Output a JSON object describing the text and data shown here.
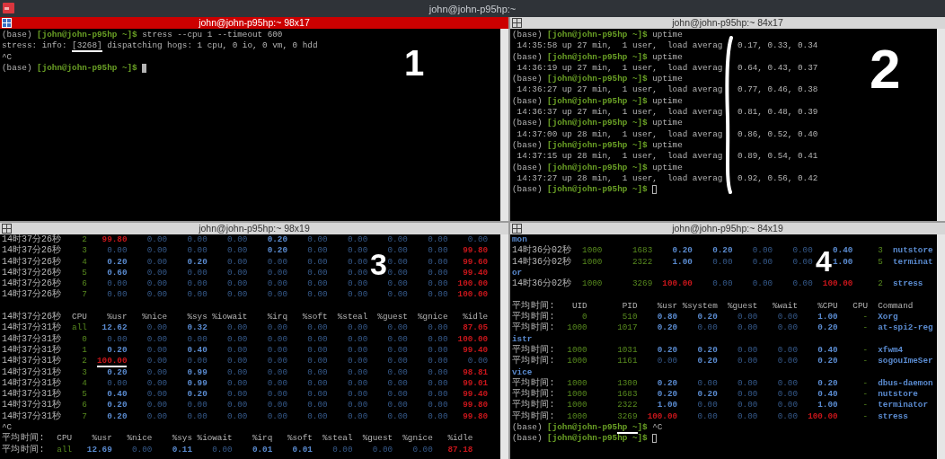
{
  "window": {
    "title": "john@john-p95hp:~"
  },
  "panes": [
    {
      "title": "john@john-p95hp:~ 98x17",
      "focused": true,
      "kind": "shell",
      "annotation": "1",
      "lines": [
        {
          "kind": "text",
          "segments": [
            {
              "text": "(base) ",
              "kind": "plain"
            },
            {
              "text": "[john@john-p95hp ~]$",
              "kind": "prompt"
            },
            {
              "text": " stress --cpu 1 --timeout 600",
              "kind": "plain"
            }
          ]
        },
        {
          "kind": "text",
          "segments": [
            {
              "text": "stress: info: ",
              "kind": "plain"
            },
            {
              "text": "[3268]",
              "kind": "plain",
              "underlined": true
            },
            {
              "text": " dispatching hogs: 1 cpu, 0 io, 0 vm, 0 hdd",
              "kind": "plain"
            }
          ]
        },
        {
          "kind": "text",
          "segments": [
            {
              "text": "^C",
              "kind": "plain"
            }
          ]
        },
        {
          "kind": "text",
          "segments": [
            {
              "text": "(base) ",
              "kind": "plain"
            },
            {
              "text": "[john@john-p95hp ~]$",
              "kind": "prompt"
            }
          ],
          "cursor": true
        }
      ]
    },
    {
      "title": "john@john-p95hp:~ 84x17",
      "focused": false,
      "kind": "shell",
      "annotation": "2",
      "bracket": true,
      "lines": [
        {
          "kind": "text",
          "segments": [
            {
              "text": "(base) ",
              "kind": "plain"
            },
            {
              "text": "[john@john-p95hp ~]$",
              "kind": "prompt"
            },
            {
              "text": " uptime",
              "kind": "plain"
            }
          ]
        },
        {
          "kind": "text",
          "segments": [
            {
              "text": " 14:35:58 up 27 min,  1 user,  load averag   0.17, 0.33, 0.34",
              "kind": "plain"
            }
          ]
        },
        {
          "kind": "text",
          "segments": [
            {
              "text": "(base) ",
              "kind": "plain"
            },
            {
              "text": "[john@john-p95hp ~]$",
              "kind": "prompt"
            },
            {
              "text": " uptime",
              "kind": "plain"
            }
          ]
        },
        {
          "kind": "text",
          "segments": [
            {
              "text": " 14:36:19 up 27 min,  1 user,  load averag   0.64, 0.43, 0.37",
              "kind": "plain"
            }
          ]
        },
        {
          "kind": "text",
          "segments": [
            {
              "text": "(base) ",
              "kind": "plain"
            },
            {
              "text": "[john@john-p95hp ~]$",
              "kind": "prompt"
            },
            {
              "text": " uptime",
              "kind": "plain"
            }
          ]
        },
        {
          "kind": "text",
          "segments": [
            {
              "text": " 14:36:27 up 27 min,  1 user,  load averag   0.77, 0.46, 0.38",
              "kind": "plain"
            }
          ]
        },
        {
          "kind": "text",
          "segments": [
            {
              "text": "(base) ",
              "kind": "plain"
            },
            {
              "text": "[john@john-p95hp ~]$",
              "kind": "prompt"
            },
            {
              "text": " uptime",
              "kind": "plain"
            }
          ]
        },
        {
          "kind": "text",
          "segments": [
            {
              "text": " 14:36:37 up 27 min,  1 user,  load averag   0.81, 0.48, 0.39",
              "kind": "plain"
            }
          ]
        },
        {
          "kind": "text",
          "segments": [
            {
              "text": "(base) ",
              "kind": "plain"
            },
            {
              "text": "[john@john-p95hp ~]$",
              "kind": "prompt"
            },
            {
              "text": " uptime",
              "kind": "plain"
            }
          ]
        },
        {
          "kind": "text",
          "segments": [
            {
              "text": " 14:37:00 up 28 min,  1 user,  load averag   0.86, 0.52, 0.40",
              "kind": "plain"
            }
          ]
        },
        {
          "kind": "text",
          "segments": [
            {
              "text": "(base) ",
              "kind": "plain"
            },
            {
              "text": "[john@john-p95hp ~]$",
              "kind": "prompt"
            },
            {
              "text": " uptime",
              "kind": "plain"
            }
          ]
        },
        {
          "kind": "text",
          "segments": [
            {
              "text": " 14:37:15 up 28 min,  1 user,  load averag   0.89, 0.54, 0.41",
              "kind": "plain"
            }
          ]
        },
        {
          "kind": "text",
          "segments": [
            {
              "text": "(base) ",
              "kind": "plain"
            },
            {
              "text": "[john@john-p95hp ~]$",
              "kind": "prompt"
            },
            {
              "text": " uptime",
              "kind": "plain"
            }
          ]
        },
        {
          "kind": "text",
          "segments": [
            {
              "text": " 14:37:27 up 28 min,  1 user,  load averag   0.92, 0.56, 0.42",
              "kind": "plain"
            }
          ]
        },
        {
          "kind": "text",
          "segments": [
            {
              "text": "(base) ",
              "kind": "plain"
            },
            {
              "text": "[john@john-p95hp ~]$",
              "kind": "prompt"
            }
          ],
          "cursor": true
        }
      ]
    },
    {
      "title": "john@john-p95hp:~ 98x19",
      "focused": false,
      "kind": "cpu_table",
      "annotation": "3",
      "lines": [
        {
          "kind": "timed_row",
          "label": "14时37分26秒",
          "cells": [
            {
              "text": "2",
              "kind": "id"
            },
            {
              "text": "99.80",
              "kind": "alert"
            },
            {
              "text": "0.00",
              "kind": "value"
            },
            {
              "text": "0.00",
              "kind": "value"
            },
            {
              "text": "0.00",
              "kind": "value"
            },
            {
              "text": "0.20",
              "kind": "highlight"
            },
            {
              "text": "0.00",
              "kind": "value"
            },
            {
              "text": "0.00",
              "kind": "value"
            },
            {
              "text": "0.00",
              "kind": "value"
            },
            {
              "text": "0.00",
              "kind": "value"
            },
            {
              "text": "0.00",
              "kind": "value"
            }
          ]
        },
        {
          "kind": "timed_row",
          "label": "14时37分26秒",
          "cells": [
            {
              "text": "3",
              "kind": "id"
            },
            {
              "text": "0.00",
              "kind": "value"
            },
            {
              "text": "0.00",
              "kind": "value"
            },
            {
              "text": "0.00",
              "kind": "value"
            },
            {
              "text": "0.00",
              "kind": "value"
            },
            {
              "text": "0.20",
              "kind": "highlight"
            },
            {
              "text": "0.00",
              "kind": "value"
            },
            {
              "text": "0.00",
              "kind": "value"
            },
            {
              "text": "0.00",
              "kind": "value"
            },
            {
              "text": "0.00",
              "kind": "value"
            },
            {
              "text": "99.80",
              "kind": "alert"
            }
          ]
        },
        {
          "kind": "timed_row",
          "label": "14时37分26秒",
          "cells": [
            {
              "text": "4",
              "kind": "id"
            },
            {
              "text": "0.20",
              "kind": "highlight"
            },
            {
              "text": "0.00",
              "kind": "value"
            },
            {
              "text": "0.20",
              "kind": "highlight"
            },
            {
              "text": "0.00",
              "kind": "value"
            },
            {
              "text": "0.00",
              "kind": "value"
            },
            {
              "text": "0.00",
              "kind": "value"
            },
            {
              "text": "0.00",
              "kind": "value"
            },
            {
              "text": "0.00",
              "kind": "value"
            },
            {
              "text": "0.00",
              "kind": "value"
            },
            {
              "text": "99.60",
              "kind": "alert"
            }
          ]
        },
        {
          "kind": "timed_row",
          "label": "14时37分26秒",
          "cells": [
            {
              "text": "5",
              "kind": "id"
            },
            {
              "text": "0.60",
              "kind": "highlight"
            },
            {
              "text": "0.00",
              "kind": "value"
            },
            {
              "text": "0.00",
              "kind": "value"
            },
            {
              "text": "0.00",
              "kind": "value"
            },
            {
              "text": "0.00",
              "kind": "value"
            },
            {
              "text": "0.00",
              "kind": "value"
            },
            {
              "text": "0.00",
              "kind": "value"
            },
            {
              "text": "0.00",
              "kind": "value"
            },
            {
              "text": "0.00",
              "kind": "value"
            },
            {
              "text": "99.40",
              "kind": "alert"
            }
          ]
        },
        {
          "kind": "timed_row",
          "label": "14时37分26秒",
          "cells": [
            {
              "text": "6",
              "kind": "id"
            },
            {
              "text": "0.00",
              "kind": "value"
            },
            {
              "text": "0.00",
              "kind": "value"
            },
            {
              "text": "0.00",
              "kind": "value"
            },
            {
              "text": "0.00",
              "kind": "value"
            },
            {
              "text": "0.00",
              "kind": "value"
            },
            {
              "text": "0.00",
              "kind": "value"
            },
            {
              "text": "0.00",
              "kind": "value"
            },
            {
              "text": "0.00",
              "kind": "value"
            },
            {
              "text": "0.00",
              "kind": "value"
            },
            {
              "text": "100.00",
              "kind": "alert"
            }
          ]
        },
        {
          "kind": "timed_row",
          "label": "14时37分26秒",
          "cells": [
            {
              "text": "7",
              "kind": "id"
            },
            {
              "text": "0.00",
              "kind": "value"
            },
            {
              "text": "0.00",
              "kind": "value"
            },
            {
              "text": "0.00",
              "kind": "value"
            },
            {
              "text": "0.00",
              "kind": "value"
            },
            {
              "text": "0.00",
              "kind": "value"
            },
            {
              "text": "0.00",
              "kind": "value"
            },
            {
              "text": "0.00",
              "kind": "value"
            },
            {
              "text": "0.00",
              "kind": "value"
            },
            {
              "text": "0.00",
              "kind": "value"
            },
            {
              "text": "100.00",
              "kind": "alert"
            }
          ]
        },
        {
          "kind": "blank"
        },
        {
          "kind": "timed_row",
          "label": "14时37分26秒",
          "cells": [
            {
              "text": "CPU",
              "kind": "plain"
            },
            {
              "text": "%usr",
              "kind": "plain"
            },
            {
              "text": "%nice",
              "kind": "plain"
            },
            {
              "text": "%sys",
              "kind": "plain"
            },
            {
              "text": "%iowait",
              "kind": "plain"
            },
            {
              "text": "%irq",
              "kind": "plain"
            },
            {
              "text": "%soft",
              "kind": "plain"
            },
            {
              "text": "%steal",
              "kind": "plain"
            },
            {
              "text": "%guest",
              "kind": "plain"
            },
            {
              "text": "%gnice",
              "kind": "plain"
            },
            {
              "text": "%idle",
              "kind": "plain"
            }
          ]
        },
        {
          "kind": "timed_row",
          "label": "14时37分31秒",
          "cells": [
            {
              "text": "all",
              "kind": "id"
            },
            {
              "text": "12.62",
              "kind": "highlight"
            },
            {
              "text": "0.00",
              "kind": "value"
            },
            {
              "text": "0.32",
              "kind": "highlight"
            },
            {
              "text": "0.00",
              "kind": "value"
            },
            {
              "text": "0.00",
              "kind": "value"
            },
            {
              "text": "0.00",
              "kind": "value"
            },
            {
              "text": "0.00",
              "kind": "value"
            },
            {
              "text": "0.00",
              "kind": "value"
            },
            {
              "text": "0.00",
              "kind": "value"
            },
            {
              "text": "87.05",
              "kind": "alert"
            }
          ]
        },
        {
          "kind": "timed_row",
          "label": "14时37分31秒",
          "cells": [
            {
              "text": "0",
              "kind": "id"
            },
            {
              "text": "0.00",
              "kind": "value"
            },
            {
              "text": "0.00",
              "kind": "value"
            },
            {
              "text": "0.00",
              "kind": "value"
            },
            {
              "text": "0.00",
              "kind": "value"
            },
            {
              "text": "0.00",
              "kind": "value"
            },
            {
              "text": "0.00",
              "kind": "value"
            },
            {
              "text": "0.00",
              "kind": "value"
            },
            {
              "text": "0.00",
              "kind": "value"
            },
            {
              "text": "0.00",
              "kind": "value"
            },
            {
              "text": "100.00",
              "kind": "alert"
            }
          ]
        },
        {
          "kind": "timed_row",
          "label": "14时37分31秒",
          "cells": [
            {
              "text": "1",
              "kind": "id"
            },
            {
              "text": "0.20",
              "kind": "highlight"
            },
            {
              "text": "0.00",
              "kind": "value"
            },
            {
              "text": "0.40",
              "kind": "highlight"
            },
            {
              "text": "0.00",
              "kind": "value"
            },
            {
              "text": "0.00",
              "kind": "value"
            },
            {
              "text": "0.00",
              "kind": "value"
            },
            {
              "text": "0.00",
              "kind": "value"
            },
            {
              "text": "0.00",
              "kind": "value"
            },
            {
              "text": "0.00",
              "kind": "value"
            },
            {
              "text": "99.40",
              "kind": "alert"
            }
          ]
        },
        {
          "kind": "timed_row",
          "label": "14时37分31秒",
          "cells": [
            {
              "text": "2",
              "kind": "id"
            },
            {
              "text": "100.00",
              "kind": "alert",
              "underlined": true
            },
            {
              "text": "0.00",
              "kind": "value"
            },
            {
              "text": "0.00",
              "kind": "value"
            },
            {
              "text": "0.00",
              "kind": "value"
            },
            {
              "text": "0.00",
              "kind": "value"
            },
            {
              "text": "0.00",
              "kind": "value"
            },
            {
              "text": "0.00",
              "kind": "value"
            },
            {
              "text": "0.00",
              "kind": "value"
            },
            {
              "text": "0.00",
              "kind": "value"
            },
            {
              "text": "0.00",
              "kind": "value"
            }
          ]
        },
        {
          "kind": "timed_row",
          "label": "14时37分31秒",
          "cells": [
            {
              "text": "3",
              "kind": "id"
            },
            {
              "text": "0.20",
              "kind": "highlight"
            },
            {
              "text": "0.00",
              "kind": "value"
            },
            {
              "text": "0.99",
              "kind": "highlight"
            },
            {
              "text": "0.00",
              "kind": "value"
            },
            {
              "text": "0.00",
              "kind": "value"
            },
            {
              "text": "0.00",
              "kind": "value"
            },
            {
              "text": "0.00",
              "kind": "value"
            },
            {
              "text": "0.00",
              "kind": "value"
            },
            {
              "text": "0.00",
              "kind": "value"
            },
            {
              "text": "98.81",
              "kind": "alert"
            }
          ]
        },
        {
          "kind": "timed_row",
          "label": "14时37分31秒",
          "cells": [
            {
              "text": "4",
              "kind": "id"
            },
            {
              "text": "0.00",
              "kind": "value"
            },
            {
              "text": "0.00",
              "kind": "value"
            },
            {
              "text": "0.99",
              "kind": "highlight"
            },
            {
              "text": "0.00",
              "kind": "value"
            },
            {
              "text": "0.00",
              "kind": "value"
            },
            {
              "text": "0.00",
              "kind": "value"
            },
            {
              "text": "0.00",
              "kind": "value"
            },
            {
              "text": "0.00",
              "kind": "value"
            },
            {
              "text": "0.00",
              "kind": "value"
            },
            {
              "text": "99.01",
              "kind": "alert"
            }
          ]
        },
        {
          "kind": "timed_row",
          "label": "14时37分31秒",
          "cells": [
            {
              "text": "5",
              "kind": "id"
            },
            {
              "text": "0.40",
              "kind": "highlight"
            },
            {
              "text": "0.00",
              "kind": "value"
            },
            {
              "text": "0.20",
              "kind": "highlight"
            },
            {
              "text": "0.00",
              "kind": "value"
            },
            {
              "text": "0.00",
              "kind": "value"
            },
            {
              "text": "0.00",
              "kind": "value"
            },
            {
              "text": "0.00",
              "kind": "value"
            },
            {
              "text": "0.00",
              "kind": "value"
            },
            {
              "text": "0.00",
              "kind": "value"
            },
            {
              "text": "99.40",
              "kind": "alert"
            }
          ]
        },
        {
          "kind": "timed_row",
          "label": "14时37分31秒",
          "cells": [
            {
              "text": "6",
              "kind": "id"
            },
            {
              "text": "0.20",
              "kind": "highlight"
            },
            {
              "text": "0.00",
              "kind": "value"
            },
            {
              "text": "0.00",
              "kind": "value"
            },
            {
              "text": "0.00",
              "kind": "value"
            },
            {
              "text": "0.00",
              "kind": "value"
            },
            {
              "text": "0.00",
              "kind": "value"
            },
            {
              "text": "0.00",
              "kind": "value"
            },
            {
              "text": "0.00",
              "kind": "value"
            },
            {
              "text": "0.00",
              "kind": "value"
            },
            {
              "text": "99.80",
              "kind": "alert"
            }
          ]
        },
        {
          "kind": "timed_row",
          "label": "14时37分31秒",
          "cells": [
            {
              "text": "7",
              "kind": "id"
            },
            {
              "text": "0.20",
              "kind": "highlight"
            },
            {
              "text": "0.00",
              "kind": "value"
            },
            {
              "text": "0.00",
              "kind": "value"
            },
            {
              "text": "0.00",
              "kind": "value"
            },
            {
              "text": "0.00",
              "kind": "value"
            },
            {
              "text": "0.00",
              "kind": "value"
            },
            {
              "text": "0.00",
              "kind": "value"
            },
            {
              "text": "0.00",
              "kind": "value"
            },
            {
              "text": "0.00",
              "kind": "value"
            },
            {
              "text": "99.80",
              "kind": "alert"
            }
          ]
        },
        {
          "kind": "text",
          "segments": [
            {
              "text": "^C",
              "kind": "plain"
            }
          ]
        },
        {
          "kind": "average_row",
          "label": "平均时间:",
          "cells": [
            {
              "text": "CPU",
              "kind": "plain"
            },
            {
              "text": "%usr",
              "kind": "plain"
            },
            {
              "text": "%nice",
              "kind": "plain"
            },
            {
              "text": "%sys",
              "kind": "plain"
            },
            {
              "text": "%iowait",
              "kind": "plain"
            },
            {
              "text": "%irq",
              "kind": "plain"
            },
            {
              "text": "%soft",
              "kind": "plain"
            },
            {
              "text": "%steal",
              "kind": "plain"
            },
            {
              "text": "%guest",
              "kind": "plain"
            },
            {
              "text": "%gnice",
              "kind": "plain"
            },
            {
              "text": "%idle",
              "kind": "plain"
            }
          ]
        },
        {
          "kind": "average_row",
          "label": "平均时间:",
          "cells": [
            {
              "text": "all",
              "kind": "id"
            },
            {
              "text": "12.69",
              "kind": "highlight"
            },
            {
              "text": "0.00",
              "kind": "value"
            },
            {
              "text": "0.11",
              "kind": "highlight"
            },
            {
              "text": "0.00",
              "kind": "value"
            },
            {
              "text": "0.01",
              "kind": "highlight"
            },
            {
              "text": "0.01",
              "kind": "highlight"
            },
            {
              "text": "0.00",
              "kind": "value"
            },
            {
              "text": "0.00",
              "kind": "value"
            },
            {
              "text": "0.00",
              "kind": "value"
            },
            {
              "text": "87.18",
              "kind": "alert"
            }
          ]
        }
      ]
    },
    {
      "title": "john@john-p95hp:~ 84x19",
      "focused": false,
      "kind": "process_table",
      "annotation": "4",
      "lines": [
        {
          "kind": "text",
          "segments": [
            {
              "text": "mon",
              "kind": "highlight"
            }
          ]
        },
        {
          "kind": "timed_row",
          "label": "14时36分02秒",
          "cells": [
            {
              "text": "1000",
              "kind": "id"
            },
            {
              "text": "1683",
              "kind": "id"
            },
            {
              "text": "0.20",
              "kind": "highlight"
            },
            {
              "text": "0.20",
              "kind": "highlight"
            },
            {
              "text": "0.00",
              "kind": "value"
            },
            {
              "text": "0.00",
              "kind": "value"
            },
            {
              "text": "0.40",
              "kind": "highlight"
            },
            {
              "text": "3",
              "kind": "id"
            },
            {
              "text": "nutstore",
              "kind": "highlight"
            }
          ]
        },
        {
          "kind": "timed_row",
          "label": "14时36分02秒",
          "cells": [
            {
              "text": "1000",
              "kind": "id"
            },
            {
              "text": "2322",
              "kind": "id"
            },
            {
              "text": "1.00",
              "kind": "highlight"
            },
            {
              "text": "0.00",
              "kind": "value"
            },
            {
              "text": "0.00",
              "kind": "value"
            },
            {
              "text": "0.00",
              "kind": "value"
            },
            {
              "text": "1.00",
              "kind": "highlight"
            },
            {
              "text": "5",
              "kind": "id"
            },
            {
              "text": "terminat",
              "kind": "highlight"
            }
          ]
        },
        {
          "kind": "text",
          "segments": [
            {
              "text": "or",
              "kind": "highlight"
            }
          ]
        },
        {
          "kind": "timed_row",
          "label": "14时36分02秒",
          "cells": [
            {
              "text": "1000",
              "kind": "id"
            },
            {
              "text": "3269",
              "kind": "id"
            },
            {
              "text": "100.00",
              "kind": "alert"
            },
            {
              "text": "0.00",
              "kind": "value"
            },
            {
              "text": "0.00",
              "kind": "value"
            },
            {
              "text": "0.00",
              "kind": "value"
            },
            {
              "text": "100.00",
              "kind": "alert"
            },
            {
              "text": "2",
              "kind": "id"
            },
            {
              "text": "stress",
              "kind": "highlight"
            }
          ]
        },
        {
          "kind": "blank"
        },
        {
          "kind": "average_row",
          "label": "平均时间:",
          "cells": [
            {
              "text": "UID",
              "kind": "plain"
            },
            {
              "text": "PID",
              "kind": "plain"
            },
            {
              "text": "%usr",
              "kind": "plain"
            },
            {
              "text": "%system",
              "kind": "plain"
            },
            {
              "text": "%guest",
              "kind": "plain"
            },
            {
              "text": "%wait",
              "kind": "plain"
            },
            {
              "text": "%CPU",
              "kind": "plain"
            },
            {
              "text": "CPU",
              "kind": "plain"
            },
            {
              "text": "Command",
              "kind": "plain"
            }
          ]
        },
        {
          "kind": "average_row",
          "label": "平均时间:",
          "cells": [
            {
              "text": "0",
              "kind": "id"
            },
            {
              "text": "510",
              "kind": "id"
            },
            {
              "text": "0.80",
              "kind": "highlight"
            },
            {
              "text": "0.20",
              "kind": "highlight"
            },
            {
              "text": "0.00",
              "kind": "value"
            },
            {
              "text": "0.00",
              "kind": "value"
            },
            {
              "text": "1.00",
              "kind": "highlight"
            },
            {
              "text": "-",
              "kind": "id"
            },
            {
              "text": "Xorg",
              "kind": "highlight"
            }
          ]
        },
        {
          "kind": "average_row",
          "label": "平均时间:",
          "cells": [
            {
              "text": "1000",
              "kind": "id"
            },
            {
              "text": "1017",
              "kind": "id"
            },
            {
              "text": "0.20",
              "kind": "highlight"
            },
            {
              "text": "0.00",
              "kind": "value"
            },
            {
              "text": "0.00",
              "kind": "value"
            },
            {
              "text": "0.00",
              "kind": "value"
            },
            {
              "text": "0.20",
              "kind": "highlight"
            },
            {
              "text": "-",
              "kind": "id"
            },
            {
              "text": "at-spi2-reg",
              "kind": "highlight"
            }
          ]
        },
        {
          "kind": "text",
          "segments": [
            {
              "text": "istr",
              "kind": "highlight"
            }
          ]
        },
        {
          "kind": "average_row",
          "label": "平均时间:",
          "cells": [
            {
              "text": "1000",
              "kind": "id"
            },
            {
              "text": "1031",
              "kind": "id"
            },
            {
              "text": "0.20",
              "kind": "highlight"
            },
            {
              "text": "0.20",
              "kind": "highlight"
            },
            {
              "text": "0.00",
              "kind": "value"
            },
            {
              "text": "0.00",
              "kind": "value"
            },
            {
              "text": "0.40",
              "kind": "highlight"
            },
            {
              "text": "-",
              "kind": "id"
            },
            {
              "text": "xfwm4",
              "kind": "highlight"
            }
          ]
        },
        {
          "kind": "average_row",
          "label": "平均时间:",
          "cells": [
            {
              "text": "1000",
              "kind": "id"
            },
            {
              "text": "1161",
              "kind": "id"
            },
            {
              "text": "0.00",
              "kind": "value"
            },
            {
              "text": "0.20",
              "kind": "highlight"
            },
            {
              "text": "0.00",
              "kind": "value"
            },
            {
              "text": "0.00",
              "kind": "value"
            },
            {
              "text": "0.20",
              "kind": "highlight"
            },
            {
              "text": "-",
              "kind": "id"
            },
            {
              "text": "sogouImeSer",
              "kind": "highlight"
            }
          ]
        },
        {
          "kind": "text",
          "segments": [
            {
              "text": "vice",
              "kind": "highlight"
            }
          ]
        },
        {
          "kind": "average_row",
          "label": "平均时间:",
          "cells": [
            {
              "text": "1000",
              "kind": "id"
            },
            {
              "text": "1300",
              "kind": "id"
            },
            {
              "text": "0.20",
              "kind": "highlight"
            },
            {
              "text": "0.00",
              "kind": "value"
            },
            {
              "text": "0.00",
              "kind": "value"
            },
            {
              "text": "0.00",
              "kind": "value"
            },
            {
              "text": "0.20",
              "kind": "highlight"
            },
            {
              "text": "-",
              "kind": "id"
            },
            {
              "text": "dbus-daemon",
              "kind": "highlight"
            }
          ]
        },
        {
          "kind": "average_row",
          "label": "平均时间:",
          "cells": [
            {
              "text": "1000",
              "kind": "id"
            },
            {
              "text": "1683",
              "kind": "id"
            },
            {
              "text": "0.20",
              "kind": "highlight"
            },
            {
              "text": "0.20",
              "kind": "highlight"
            },
            {
              "text": "0.00",
              "kind": "value"
            },
            {
              "text": "0.00",
              "kind": "value"
            },
            {
              "text": "0.40",
              "kind": "highlight"
            },
            {
              "text": "-",
              "kind": "id"
            },
            {
              "text": "nutstore",
              "kind": "highlight"
            }
          ]
        },
        {
          "kind": "average_row",
          "label": "平均时间:",
          "cells": [
            {
              "text": "1000",
              "kind": "id"
            },
            {
              "text": "2322",
              "kind": "id"
            },
            {
              "text": "1.00",
              "kind": "highlight"
            },
            {
              "text": "0.00",
              "kind": "value"
            },
            {
              "text": "0.00",
              "kind": "value"
            },
            {
              "text": "0.00",
              "kind": "value"
            },
            {
              "text": "1.00",
              "kind": "highlight"
            },
            {
              "text": "-",
              "kind": "id"
            },
            {
              "text": "terminator",
              "kind": "highlight"
            }
          ]
        },
        {
          "kind": "average_row",
          "label": "平均时间:",
          "cells": [
            {
              "text": "1000",
              "kind": "id"
            },
            {
              "text": "3269",
              "kind": "id"
            },
            {
              "text": "100.00",
              "kind": "alert"
            },
            {
              "text": "0.00",
              "kind": "value"
            },
            {
              "text": "0.00",
              "kind": "value"
            },
            {
              "text": "0.00",
              "kind": "value"
            },
            {
              "text": "100.00",
              "kind": "alert"
            },
            {
              "text": "-",
              "kind": "id"
            },
            {
              "text": "stress",
              "kind": "highlight"
            }
          ]
        },
        {
          "kind": "text",
          "segments": [
            {
              "text": "(base) ",
              "kind": "plain"
            },
            {
              "text": "[john@john-p95",
              "kind": "prompt"
            },
            {
              "text": "hp ~",
              "kind": "prompt",
              "underlined": true
            },
            {
              "text": "]$",
              "kind": "prompt"
            },
            {
              "text": " ^C",
              "kind": "plain"
            }
          ]
        },
        {
          "kind": "text",
          "segments": [
            {
              "text": "(base) ",
              "kind": "plain"
            },
            {
              "text": "[john@john-p95hp ~]$",
              "kind": "prompt"
            }
          ],
          "cursor": true
        }
      ]
    }
  ]
}
